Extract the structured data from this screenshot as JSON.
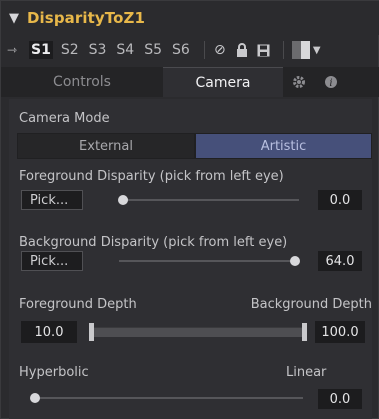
{
  "tool": {
    "title": "DisparityToZ1"
  },
  "versions": {
    "items": [
      "S1",
      "S2",
      "S3",
      "S4",
      "S5",
      "S6"
    ],
    "active_index": 0
  },
  "tabs": {
    "controls_label": "Controls",
    "camera_label": "Camera",
    "active": "Camera"
  },
  "camera": {
    "mode_label": "Camera Mode",
    "mode_options": [
      "External",
      "Artistic"
    ],
    "mode_selected": "Artistic",
    "fg_disparity": {
      "label": "Foreground Disparity (pick from left eye)",
      "pick_label": "Pick...",
      "value": "0.0",
      "slider_fraction": 0.0
    },
    "bg_disparity": {
      "label": "Background Disparity (pick from left eye)",
      "pick_label": "Pick...",
      "value": "64.0",
      "slider_fraction": 1.0
    },
    "depth": {
      "fg_label": "Foreground Depth",
      "bg_label": "Background Depth",
      "fg_value": "10.0",
      "bg_value": "100.0"
    },
    "falloff": {
      "left_label": "Hyperbolic",
      "right_label": "Linear",
      "value": "0.0",
      "slider_fraction": 0.0
    }
  },
  "colors": {
    "title": "#e8b84a",
    "selected_mode": "#46507a",
    "panel": "#2f2f33"
  },
  "icons": {
    "collapse": "chevron-down-icon",
    "pin": "pin-icon",
    "disable": "disable-icon",
    "lock": "lock-icon",
    "save": "save-icon",
    "color": "tile-color-icon",
    "settings": "gear-icon",
    "info": "info-icon"
  }
}
